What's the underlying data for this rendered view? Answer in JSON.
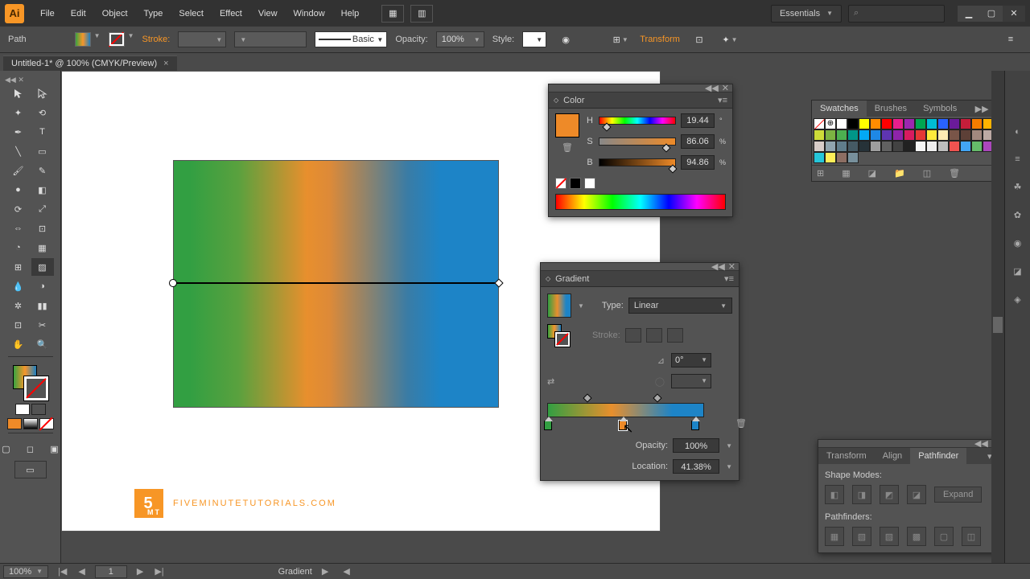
{
  "app": {
    "logo": "Ai"
  },
  "menu": [
    "File",
    "Edit",
    "Object",
    "Type",
    "Select",
    "Effect",
    "View",
    "Window",
    "Help"
  ],
  "workspace_switcher": "Essentials",
  "control": {
    "path_label": "Path",
    "stroke_label": "Stroke:",
    "basic": "Basic",
    "opacity_label": "Opacity:",
    "opacity_value": "100%",
    "style_label": "Style:",
    "transform": "Transform"
  },
  "tab": {
    "title": "Untitled-1* @ 100% (CMYK/Preview)"
  },
  "watermark": "FIVEMINUTETUTORIALS.COM",
  "color_panel": {
    "title": "Color",
    "h": {
      "label": "H",
      "value": "19.44",
      "unit": "°"
    },
    "s": {
      "label": "S",
      "value": "86.06",
      "unit": "%"
    },
    "b": {
      "label": "B",
      "value": "94.86",
      "unit": "%"
    }
  },
  "gradient_panel": {
    "title": "Gradient",
    "type_label": "Type:",
    "type_value": "Linear",
    "stroke_label": "Stroke:",
    "angle_value": "0°",
    "opacity_label": "Opacity:",
    "opacity_value": "100%",
    "location_label": "Location:",
    "location_value": "41.38%",
    "stops": [
      {
        "pos": 0,
        "color": "#329f42"
      },
      {
        "pos": 41,
        "color": "#ee8a28"
      },
      {
        "pos": 80,
        "color": "#1d84c7"
      }
    ]
  },
  "dock": {
    "swatches_tabs": [
      "Swatches",
      "Brushes",
      "Symbols"
    ],
    "swatch_colors": [
      "#ffffff",
      "#000000",
      "#ffff00",
      "#ff8c00",
      "#ff0000",
      "#e91e8c",
      "#9c27b0",
      "#00a651",
      "#00bcd4",
      "#2962ff",
      "#6a1b9a",
      "#c41e3a",
      "#f57c00",
      "#ffb300",
      "#cddc39",
      "#7cb342",
      "#4caf50",
      "#009688",
      "#03a9f4",
      "#1e88e5",
      "#5e35b1",
      "#8e24aa",
      "#d81b60",
      "#e53935",
      "#ffeb3b",
      "#ffecb3",
      "#795548",
      "#5d4037",
      "#a1887f",
      "#bcaaa4",
      "#d7ccc8",
      "#90a4ae",
      "#607d8b",
      "#455a64",
      "#263238",
      "#9e9e9e",
      "#616161",
      "#424242",
      "#212121",
      "#f5f5f5",
      "#eeeeee",
      "#bdbdbd",
      "#ef5350",
      "#42a5f5",
      "#66bb6a",
      "#ab47bc",
      "#26c6da",
      "#ffee58",
      "#8d6e63",
      "#78909c"
    ]
  },
  "pathfinder": {
    "tabs": [
      "Transform",
      "Align",
      "Pathfinder"
    ],
    "shape_modes": "Shape Modes:",
    "pathfinders": "Pathfinders:",
    "expand": "Expand"
  },
  "status": {
    "zoom": "100%",
    "artboard_page": "1",
    "tool": "Gradient"
  }
}
